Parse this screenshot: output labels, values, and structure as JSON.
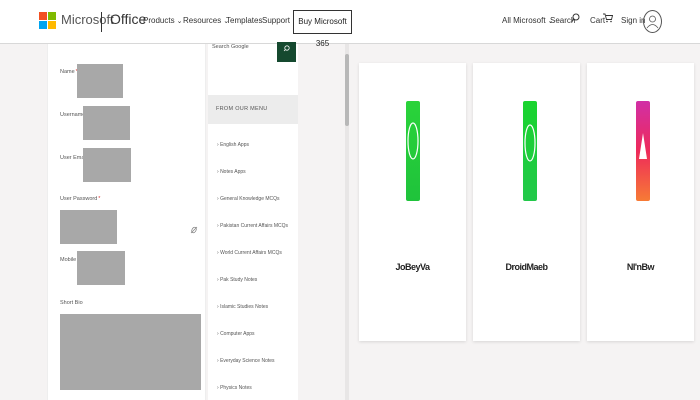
{
  "header": {
    "brand": "Microsoft",
    "product": "Office",
    "nav": [
      {
        "label": "Products",
        "has_dropdown": true
      },
      {
        "label": "Resources",
        "has_dropdown": true
      },
      {
        "label": "Templates",
        "has_dropdown": false
      },
      {
        "label": "Support",
        "has_dropdown": false
      }
    ],
    "buy_button": "Buy Microsoft 365",
    "all_microsoft": "All Microsoft",
    "search": "Search",
    "cart": "Cart",
    "sign_in": "Sign in",
    "colors": {
      "ms_red": "#f25022",
      "ms_green": "#7fba00",
      "ms_blue": "#00a4ef",
      "ms_yellow": "#ffb900"
    }
  },
  "form": {
    "fields": [
      {
        "label": "Name",
        "required": true
      },
      {
        "label": "Username",
        "required": true
      },
      {
        "label": "User Email",
        "required": true
      },
      {
        "label": "User Password",
        "required": true
      },
      {
        "label": "Mobile",
        "required": true
      },
      {
        "label": "Short Bio",
        "required": false
      }
    ]
  },
  "sidebar": {
    "search_label": "Search Google",
    "section_title": "FROM OUR MENU",
    "items": [
      "English Apps",
      "Notes Apps",
      "General Knowledge MCQs",
      "Pakistan Current Affairs MCQs",
      "World Current Affairs MCQs",
      "Pak Study Notes",
      "Islamic Studies Notes",
      "Computer Apps",
      "Everyday Science Notes",
      "Physics Notes"
    ]
  },
  "cards": [
    {
      "name": "JoBeyVa",
      "icon": "whatsapp-green-icon",
      "color": "#22c93a"
    },
    {
      "name": "DroidMaeb",
      "icon": "whatsapp-green-icon",
      "color": "#1ed03c"
    },
    {
      "name": "NI'nBw",
      "icon": "instagram-gradient-icon",
      "color": "#e1306c"
    }
  ]
}
